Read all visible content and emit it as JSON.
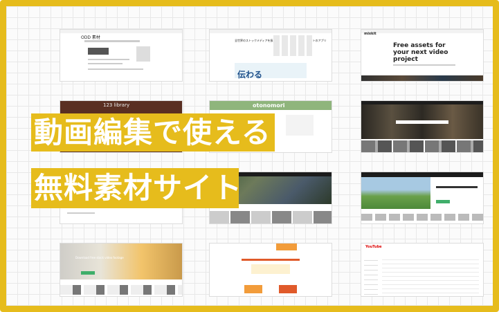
{
  "banner": {
    "line1": "動画編集で使える",
    "line2": "無料素材サイト"
  },
  "thumbs": {
    "t1_title": "ODD 素材",
    "t2_title": "全世界のストックメディアを扱うワイヤマティクリー マーケットのアプリ",
    "t2_sub": "伝わる",
    "t3_title": "Free assets for your next video project",
    "t3_logo": "mixkit",
    "t4_title": "123 library",
    "t5_title": "otonomori",
    "t7_caption": "Download free stock video footage",
    "t9_logo": "YouTube"
  },
  "colors": {
    "accent": "#e6bc1c"
  }
}
